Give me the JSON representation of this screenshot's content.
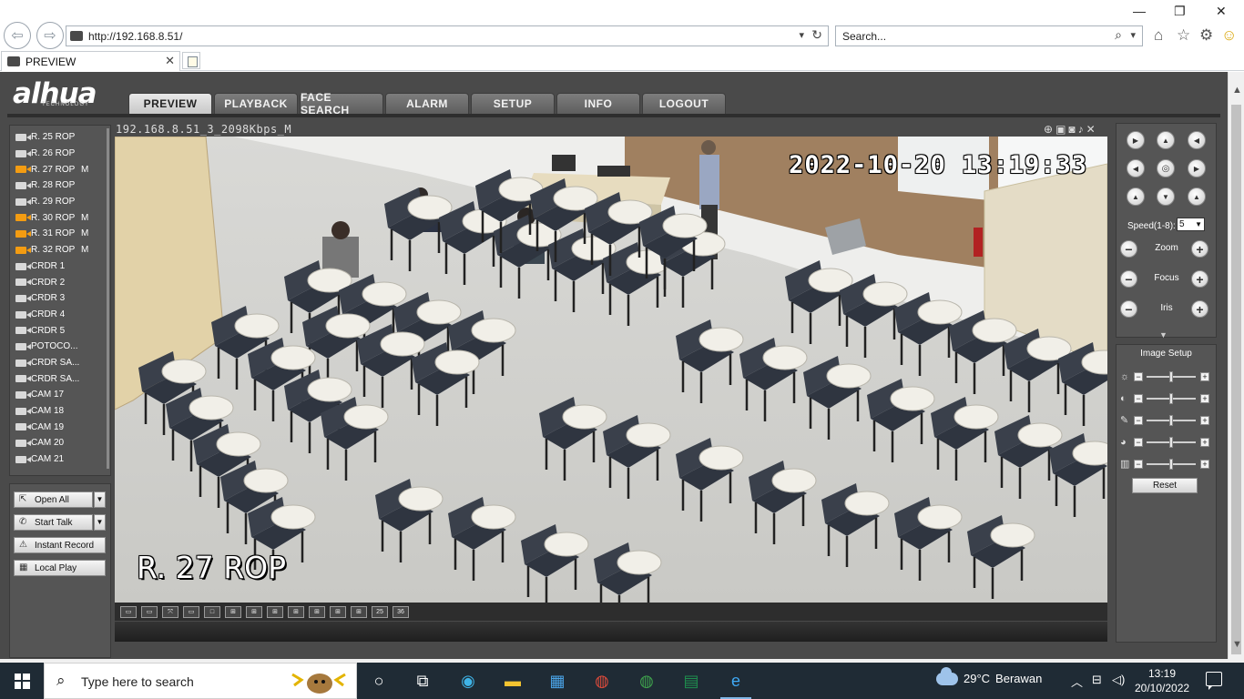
{
  "browser": {
    "url": "http://192.168.8.51/",
    "search_placeholder": "Search...",
    "tab_title": "PREVIEW",
    "win_min": "—",
    "win_restore": "❐",
    "win_close": "✕"
  },
  "app": {
    "logo": "alhua",
    "logo_sub": "TECHNOLOGY",
    "nav": [
      "PREVIEW",
      "PLAYBACK",
      "FACE SEARCH",
      "ALARM",
      "SETUP",
      "INFO",
      "LOGOUT"
    ],
    "active_nav": 0,
    "cameras": [
      {
        "name": "R. 25 ROP",
        "flag": "",
        "active": false
      },
      {
        "name": "R. 26 ROP",
        "flag": "",
        "active": false
      },
      {
        "name": "R. 27 ROP",
        "flag": "M",
        "active": true
      },
      {
        "name": "R. 28 ROP",
        "flag": "",
        "active": false
      },
      {
        "name": "R. 29 ROP",
        "flag": "",
        "active": false
      },
      {
        "name": "R. 30 ROP",
        "flag": "M",
        "active": true
      },
      {
        "name": "R. 31 ROP",
        "flag": "M",
        "active": true
      },
      {
        "name": "R. 32 ROP",
        "flag": "M",
        "active": true
      },
      {
        "name": "CRDR 1",
        "flag": "",
        "active": false
      },
      {
        "name": "CRDR 2",
        "flag": "",
        "active": false
      },
      {
        "name": "CRDR 3",
        "flag": "",
        "active": false
      },
      {
        "name": "CRDR 4",
        "flag": "",
        "active": false
      },
      {
        "name": "CRDR 5",
        "flag": "",
        "active": false
      },
      {
        "name": "POTOCO...",
        "flag": "",
        "active": false
      },
      {
        "name": "CRDR SA...",
        "flag": "",
        "active": false
      },
      {
        "name": "CRDR SA...",
        "flag": "",
        "active": false
      },
      {
        "name": "CAM 17",
        "flag": "",
        "active": false
      },
      {
        "name": "CAM 18",
        "flag": "",
        "active": false
      },
      {
        "name": "CAM 19",
        "flag": "",
        "active": false
      },
      {
        "name": "CAM 20",
        "flag": "",
        "active": false
      },
      {
        "name": "CAM 21",
        "flag": "",
        "active": false
      }
    ],
    "buttons": {
      "open_all": "Open All",
      "start_talk": "Start Talk",
      "instant_record": "Instant Record",
      "local_play": "Local Play"
    },
    "video": {
      "stream_title": "192.168.8.51_3_2098Kbps_M",
      "osd_time": "2022-10-20 13:19:33",
      "osd_name": "R. 27 ROP"
    },
    "layouts": [
      "▭",
      "▭",
      "⤧",
      "▭",
      "□",
      "⊞",
      "⊞",
      "⊞",
      "⊞",
      "⊞",
      "⊞",
      "⊞",
      "25",
      "36"
    ],
    "ptz": {
      "speed_label": "Speed(1-8):",
      "speed_value": "5",
      "zoom_label": "Zoom",
      "focus_label": "Focus",
      "iris_label": "Iris"
    },
    "image_setup": {
      "title": "Image Setup",
      "reset": "Reset",
      "rows": [
        {
          "icon": "brightness-icon",
          "level": 0.5
        },
        {
          "icon": "contrast-icon",
          "level": 0.5
        },
        {
          "icon": "saturation-icon",
          "level": 0.5
        },
        {
          "icon": "hue-icon",
          "level": 0.5
        },
        {
          "icon": "gamma-icon",
          "level": 0.5
        }
      ]
    }
  },
  "taskbar": {
    "search_placeholder": "Type here to search",
    "weather_temp": "29°C",
    "weather_text": "Berawan",
    "time": "13:19",
    "date": "20/10/2022"
  }
}
